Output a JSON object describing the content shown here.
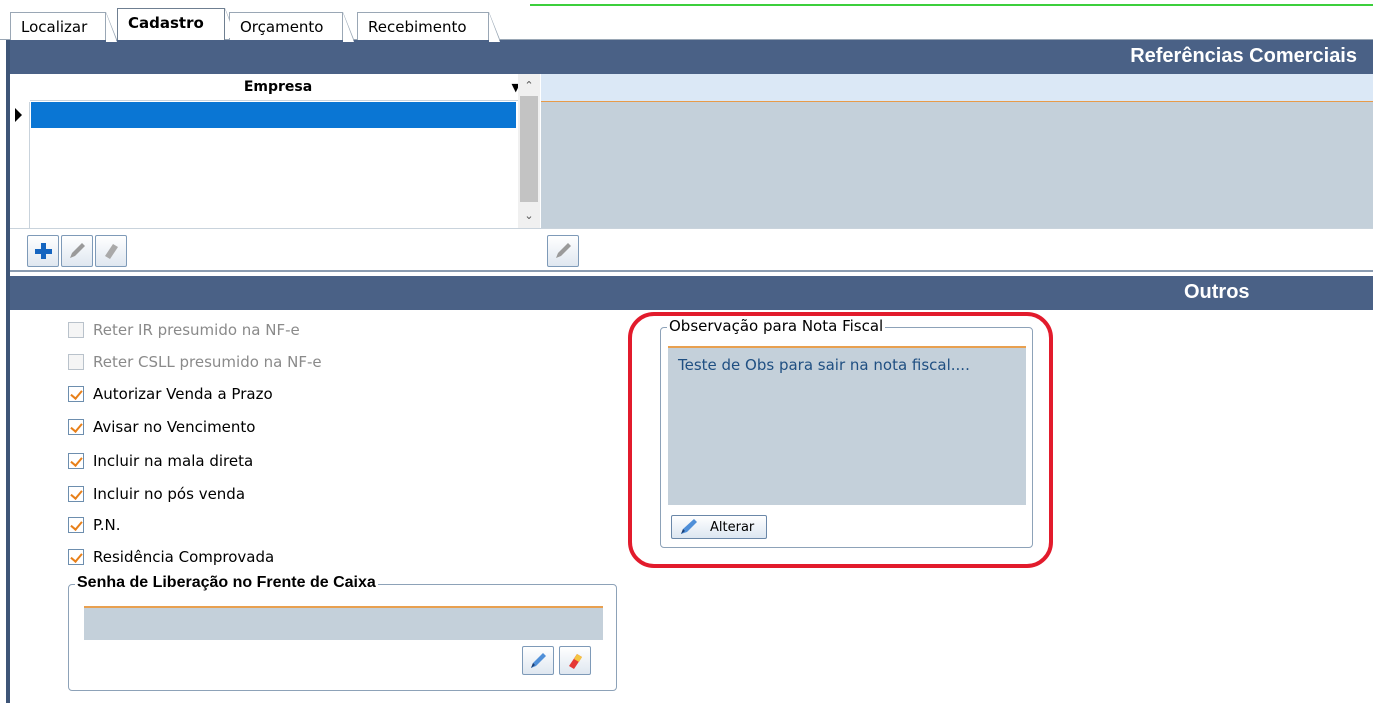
{
  "tabs": [
    {
      "label": "Localizar",
      "active": false
    },
    {
      "label": "Cadastro",
      "active": true
    },
    {
      "label": "Orçamento",
      "active": false
    },
    {
      "label": "Recebimento",
      "active": false
    }
  ],
  "referencias": {
    "title": "Referências Comerciais",
    "grid": {
      "columns": [
        "Empresa"
      ],
      "rows": [
        ""
      ]
    },
    "toolbar_icons": [
      "plus-icon",
      "edit-pencil-icon",
      "eraser-icon"
    ],
    "detail_icons": [
      "edit-pencil-icon"
    ]
  },
  "outros": {
    "title": "Outros",
    "checkboxes": [
      {
        "label": "Reter IR presumido na NF-e",
        "checked": false,
        "enabled": false
      },
      {
        "label": "Reter CSLL presumido na NF-e",
        "checked": false,
        "enabled": false
      },
      {
        "label": "Autorizar Venda a Prazo",
        "checked": true,
        "enabled": true
      },
      {
        "label": "Avisar no Vencimento",
        "checked": true,
        "enabled": true
      },
      {
        "label": "Incluir na mala direta",
        "checked": true,
        "enabled": true
      },
      {
        "label": "Incluir no pós venda",
        "checked": true,
        "enabled": true
      },
      {
        "label": "P.N.",
        "checked": true,
        "enabled": true
      },
      {
        "label": "Residência Comprovada",
        "checked": true,
        "enabled": true
      }
    ],
    "senha": {
      "title": "Senha de Liberação no Frente de Caixa",
      "value": "",
      "icons": [
        "edit-pencil-icon",
        "eraser-icon"
      ]
    },
    "observacao": {
      "title": "Observação para Nota Fiscal",
      "text": "Teste de Obs para sair na nota fiscal....",
      "button_label": "Alterar"
    }
  },
  "colors": {
    "header_bg": "#4a6186",
    "selection": "#0a76d4",
    "field_bg": "#c4d0da",
    "accent_orange": "#e8a050",
    "highlight_red": "#e21b2c"
  }
}
